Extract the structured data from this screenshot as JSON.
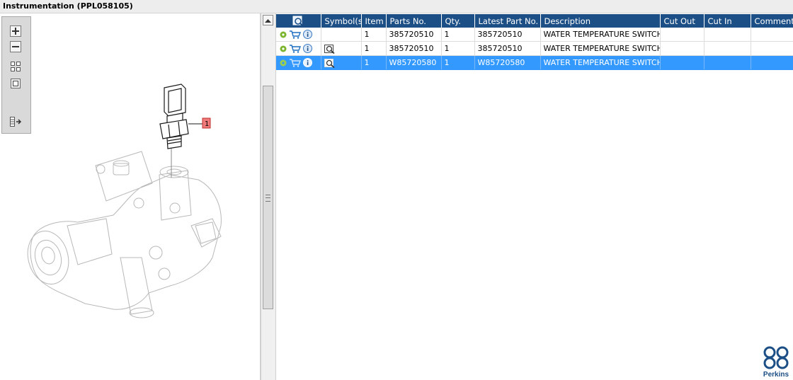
{
  "window": {
    "title": "Instrumentation (PPL058105)"
  },
  "toolbar": {
    "buttons": [
      "zoom-in-icon",
      "zoom-out-icon",
      "fit-all-icon",
      "fit-window-icon",
      "toggle-list-icon"
    ]
  },
  "drawing": {
    "callout": "1"
  },
  "table": {
    "columns": [
      "",
      "Symbol(s)",
      "Item",
      "Parts No.",
      "Qty.",
      "Latest Part No.",
      "Description",
      "Cut Out",
      "Cut In",
      "Comment"
    ],
    "rows": [
      {
        "symbol": "",
        "item": "1",
        "parts_no": "385720510",
        "qty": "1",
        "latest": "385720510",
        "description": "WATER TEMPERATURE SWITCH",
        "cut_out": "",
        "cut_in": "",
        "comment": "",
        "selected": false
      },
      {
        "symbol": "magnifier-icon",
        "item": "1",
        "parts_no": "385720510",
        "qty": "1",
        "latest": "385720510",
        "description": "WATER TEMPERATURE SWITCH",
        "cut_out": "",
        "cut_in": "",
        "comment": "",
        "selected": false
      },
      {
        "symbol": "magnifier-icon",
        "item": "1",
        "parts_no": "W85720580",
        "qty": "1",
        "latest": "W85720580",
        "description": "WATER TEMPERATURE SWITCH",
        "cut_out": "",
        "cut_in": "",
        "comment": "",
        "selected": true
      }
    ]
  },
  "brand": {
    "name": "Perkins",
    "color": "#1c4f86"
  },
  "colors": {
    "header": "#1c4f86",
    "selection": "#3399ff",
    "callout": "#f07a7a"
  }
}
